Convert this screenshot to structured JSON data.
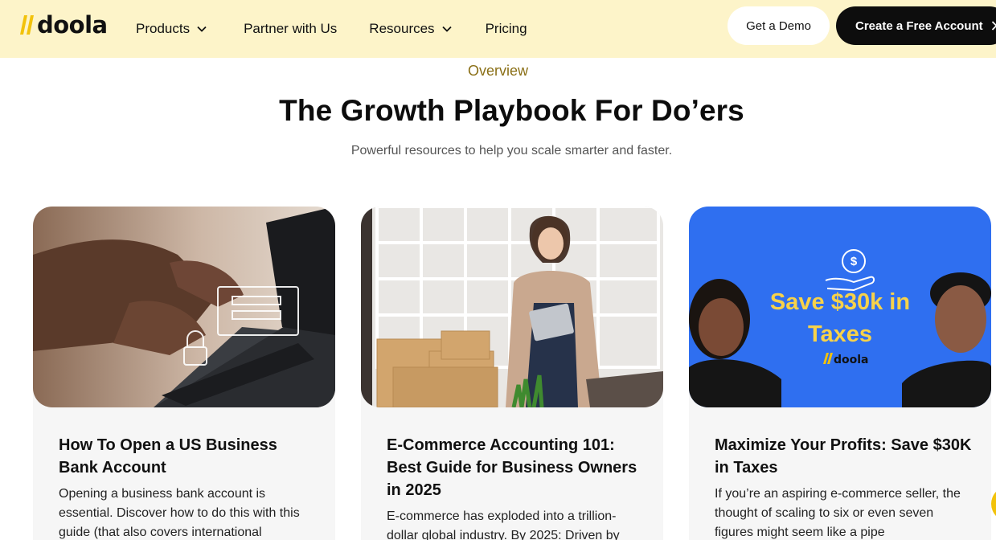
{
  "brand": {
    "name": "doola",
    "accent": "#f2c20b",
    "header_bg": "#fdf4c9"
  },
  "nav": {
    "items": [
      {
        "label": "Products",
        "has_dropdown": true
      },
      {
        "label": "Partner with Us",
        "has_dropdown": false
      },
      {
        "label": "Resources",
        "has_dropdown": true
      },
      {
        "label": "Pricing",
        "has_dropdown": false
      }
    ],
    "demo_button": "Get a Demo",
    "create_button": "Create a Free Account"
  },
  "hero": {
    "eyebrow": "Overview",
    "title": "The Growth Playbook For Do’ers",
    "subtitle": "Powerful resources to help you scale smarter and faster."
  },
  "cards": [
    {
      "title": "How To Open a US Business Bank Account",
      "description": "Opening a business bank account is essential. Discover how to do this with this guide (that also covers international",
      "image": "laptop-security-photo"
    },
    {
      "title": "E-Commerce Accounting 101: Best Guide for Business Owners in 2025",
      "description": "E-commerce has exploded into a trillion-dollar global industry. By 2025: Driven by",
      "image": "woman-with-boxes-photo"
    },
    {
      "title": "Maximize Your Profits: Save $30K in Taxes",
      "description": "If you’re an aspiring e-commerce seller, the thought of scaling to six or even seven figures might seem like a pipe",
      "image": "promo-banner",
      "promo": {
        "line1": "Save $30k in",
        "line2": "Taxes",
        "logo": "doola",
        "bg": "#2f6ff0",
        "text_color": "#f7d24a"
      }
    }
  ]
}
